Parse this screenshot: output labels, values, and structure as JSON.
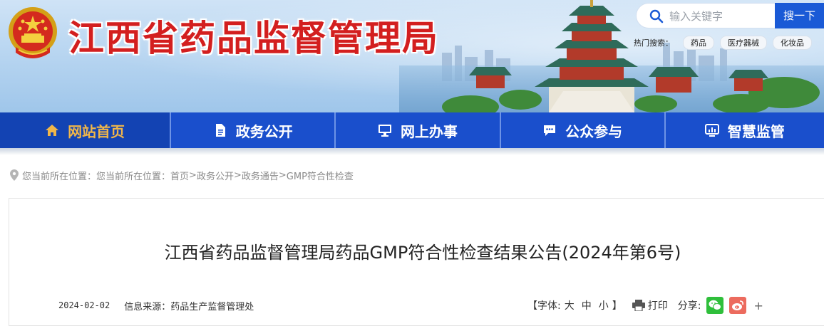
{
  "header": {
    "site_title": "江西省药品监督管理局",
    "search": {
      "placeholder": "输入关键字",
      "button_label": "搜一下"
    },
    "hot_search": {
      "label": "热门搜索：",
      "tags": [
        "药品",
        "医疗器械",
        "化妆品"
      ]
    }
  },
  "nav": {
    "items": [
      {
        "label": "网站首页",
        "icon": "home-icon",
        "active": true
      },
      {
        "label": "政务公开",
        "icon": "document-icon",
        "active": false
      },
      {
        "label": "网上办事",
        "icon": "monitor-icon",
        "active": false
      },
      {
        "label": "公众参与",
        "icon": "chat-icon",
        "active": false
      },
      {
        "label": "智慧监管",
        "icon": "screen-chart-icon",
        "active": false
      }
    ]
  },
  "breadcrumb": {
    "prefix": "您当前所在位置：您当前所在位置：",
    "path": [
      "首页",
      "政务公开",
      "政务通告",
      "GMP符合性检查"
    ],
    "separator": ">"
  },
  "article": {
    "title": "江西省药品监督管理局药品GMP符合性检查结果公告(2024年第6号)",
    "date": "2024-02-02",
    "source": "信息来源：药品生产监督管理处",
    "font_label_open": "【字体:",
    "font_large": "大",
    "font_medium": "中",
    "font_small": "小",
    "font_label_close": "】",
    "print_label": "打印",
    "share_label": "分享:",
    "more_label": "+"
  },
  "colors": {
    "title_red": "#d31f1f",
    "nav_blue": "#1a4fcc",
    "nav_active_text": "#f0b64a",
    "search_button": "#1a5ad6"
  }
}
